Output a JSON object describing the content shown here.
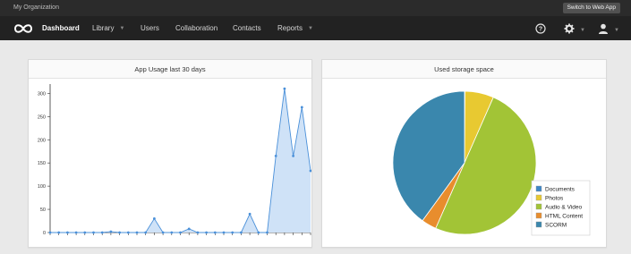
{
  "header": {
    "org_name": "My Organization",
    "switch_label": "Switch to Web App"
  },
  "nav": {
    "items": [
      {
        "label": "Dashboard",
        "active": true,
        "dropdown": false
      },
      {
        "label": "Library",
        "active": false,
        "dropdown": true
      },
      {
        "label": "Users",
        "active": false,
        "dropdown": false
      },
      {
        "label": "Collaboration",
        "active": false,
        "dropdown": false
      },
      {
        "label": "Contacts",
        "active": false,
        "dropdown": false
      },
      {
        "label": "Reports",
        "active": false,
        "dropdown": true
      }
    ],
    "icons": [
      "help-icon",
      "gear-icon",
      "user-icon"
    ]
  },
  "usage_card": {
    "title": "App Usage last 30 days"
  },
  "storage_card": {
    "title": "Used storage space"
  },
  "chart_data": [
    {
      "type": "area",
      "title": "App Usage last 30 days",
      "x": [
        1,
        2,
        3,
        4,
        5,
        6,
        7,
        8,
        9,
        10,
        11,
        12,
        13,
        14,
        15,
        16,
        17,
        18,
        19,
        20,
        21,
        22,
        23,
        24,
        25,
        26,
        27,
        28,
        29,
        30,
        31
      ],
      "values": [
        0,
        0,
        0,
        0,
        0,
        0,
        0,
        2,
        0,
        0,
        0,
        0,
        30,
        0,
        0,
        0,
        8,
        0,
        0,
        0,
        0,
        0,
        0,
        40,
        0,
        0,
        165,
        310,
        165,
        270,
        133
      ],
      "ylim": [
        0,
        320
      ],
      "yticks": [
        0,
        50,
        100,
        150,
        200,
        250,
        300
      ],
      "xlabel": "",
      "ylabel": "",
      "grid": false,
      "colors": {
        "line": "#4a90d9",
        "fill": "#cfe2f7"
      }
    },
    {
      "type": "pie",
      "title": "Used storage space",
      "labels": [
        "Documents",
        "Photos",
        "Audio & Video",
        "HTML Content",
        "SCORM"
      ],
      "values": [
        0.1,
        6.5,
        50,
        3.4,
        40
      ],
      "colors": [
        "#3d85c6",
        "#e8c931",
        "#a2c436",
        "#e88d2d",
        "#3a87ad"
      ],
      "legend": "bottom-right"
    }
  ]
}
